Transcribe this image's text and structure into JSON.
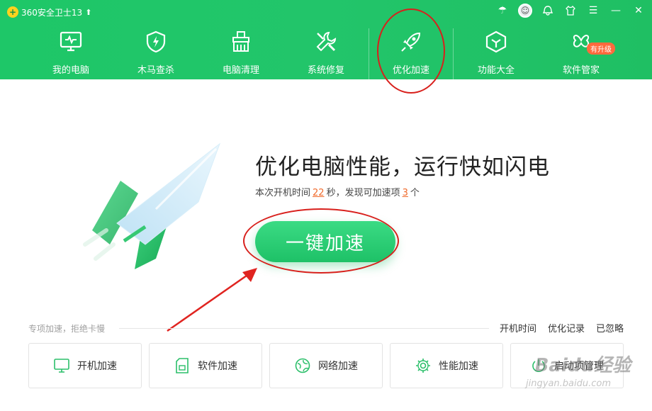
{
  "app": {
    "logo": "+",
    "title": "360安全卫士13",
    "update_icon": "up-arrow-icon"
  },
  "window_controls": [
    {
      "name": "umbrella-icon",
      "glyph": "☂"
    },
    {
      "name": "avatar",
      "glyph": "☺"
    },
    {
      "name": "notification-icon",
      "glyph": "✿"
    },
    {
      "name": "skin-icon",
      "glyph": "⬚"
    },
    {
      "name": "menu-icon",
      "glyph": "☰"
    },
    {
      "name": "minimize-icon",
      "glyph": "—"
    },
    {
      "name": "close-icon",
      "glyph": "✕"
    }
  ],
  "nav": [
    {
      "label": "我的电脑",
      "icon": "monitor-icon"
    },
    {
      "label": "木马查杀",
      "icon": "shield-icon"
    },
    {
      "label": "电脑清理",
      "icon": "broom-icon"
    },
    {
      "label": "系统修复",
      "icon": "wrench-icon"
    },
    {
      "label": "优化加速",
      "icon": "rocket-icon",
      "active": true
    },
    {
      "label": "功能大全",
      "icon": "cube-icon"
    },
    {
      "label": "软件管家",
      "icon": "clover-icon",
      "badge": "有升级"
    }
  ],
  "hero": {
    "title": "优化电脑性能，运行快如闪电",
    "sub_prefix": "本次开机时间",
    "boot_seconds": "22",
    "sub_mid": "秒，发现可加速项",
    "items_count": "3",
    "sub_suffix": "个",
    "button": "一键加速"
  },
  "section": {
    "label": "专项加速，拒绝卡慢",
    "links": [
      "开机时间",
      "优化记录",
      "已忽略"
    ]
  },
  "cards": [
    {
      "label": "开机加速",
      "icon": "monitor-icon"
    },
    {
      "label": "软件加速",
      "icon": "sd-card-icon"
    },
    {
      "label": "网络加速",
      "icon": "globe-icon"
    },
    {
      "label": "性能加速",
      "icon": "gear-icon"
    },
    {
      "label": "启动项管理",
      "icon": "power-icon"
    }
  ],
  "watermark": {
    "main": "Baidu经验",
    "url": "jingyan.baidu.com"
  },
  "colors": {
    "accent": "#22c56a",
    "highlight": "#f06a2b",
    "annotation": "#d8201c"
  }
}
